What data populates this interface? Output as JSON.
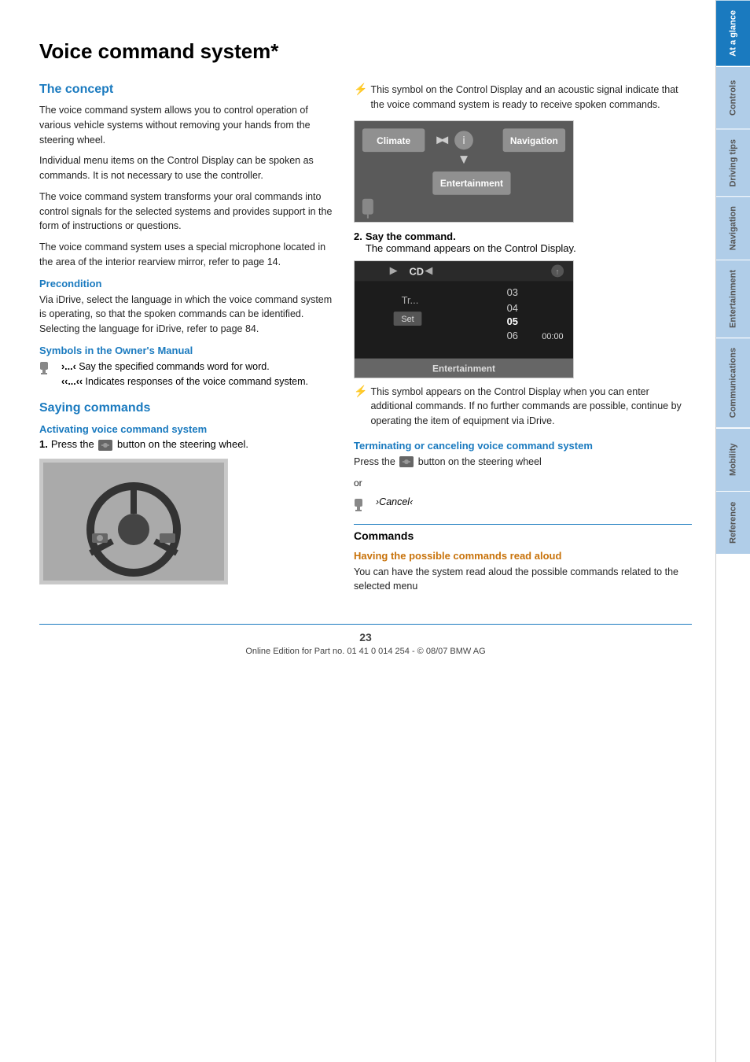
{
  "page": {
    "title": "Voice command system*",
    "footer_text": "Online Edition for Part no. 01 41 0 014 254 - © 08/07 BMW AG",
    "page_number": "23"
  },
  "sidebar": {
    "tabs": [
      {
        "id": "at-a-glance",
        "label": "At a glance",
        "active": true
      },
      {
        "id": "controls",
        "label": "Controls",
        "active": false
      },
      {
        "id": "driving-tips",
        "label": "Driving tips",
        "active": false
      },
      {
        "id": "navigation",
        "label": "Navigation",
        "active": false
      },
      {
        "id": "entertainment",
        "label": "Entertainment",
        "active": false
      },
      {
        "id": "communications",
        "label": "Communications",
        "active": false
      },
      {
        "id": "mobility",
        "label": "Mobility",
        "active": false
      },
      {
        "id": "reference",
        "label": "Reference",
        "active": false
      }
    ]
  },
  "concept": {
    "heading": "The concept",
    "paragraphs": [
      "The voice command system allows you to control operation of various vehicle systems without removing your hands from the steering wheel.",
      "Individual menu items on the Control Display can be spoken as commands. It is not necessary to use the controller.",
      "The voice command system transforms your oral commands into control signals for the selected systems and provides support in the form of instructions or questions.",
      "The voice command system uses a special microphone located in the area of the interior rearview mirror, refer to page 14."
    ],
    "precondition_heading": "Precondition",
    "precondition_text": "Via iDrive, select the language in which the voice command system is operating, so that the spoken commands can be identified. Selecting the language for iDrive, refer to page 84.",
    "symbols_heading": "Symbols in the Owner's Manual",
    "symbols": [
      {
        "symbol": "›...‹",
        "text": "Say the specified commands word for word."
      },
      {
        "symbol": "››...‹‹",
        "text": "Indicates responses of the voice command system."
      }
    ]
  },
  "saying_commands": {
    "heading": "Saying commands",
    "activating_heading": "Activating voice command system",
    "step1": "Press the",
    "step1_end": "button on the steering wheel.",
    "symbol_text_right": "This symbol on the Control Display and an acoustic signal indicate that the voice command system is ready to receive spoken commands.",
    "step2_number": "2.",
    "step2_text": "Say the command.",
    "step2_subtext": "The command appears on the Control Display.",
    "symbol_text_right2": "This symbol appears on the Control Display when you can enter additional commands. If no further commands are possible, continue by operating the item of equipment via iDrive."
  },
  "terminating": {
    "heading": "Terminating or canceling voice command system",
    "text1": "Press the",
    "text1_end": "button on the steering wheel",
    "text2": "or",
    "cancel_text": "›Cancel‹"
  },
  "commands": {
    "heading": "Commands",
    "having_heading": "Having the possible commands read aloud",
    "having_text": "You can have the system read aloud the possible commands related to the selected menu"
  },
  "menu_display": {
    "climate": "Climate",
    "navigation": "Navigation",
    "entertainment": "Entertainment"
  },
  "entertainment_display": {
    "cd_label": "CD",
    "tracks": [
      "03",
      "04",
      "05",
      "06"
    ],
    "set_label": "Set",
    "time": "00:00",
    "bottom_label": "Entertainment"
  }
}
